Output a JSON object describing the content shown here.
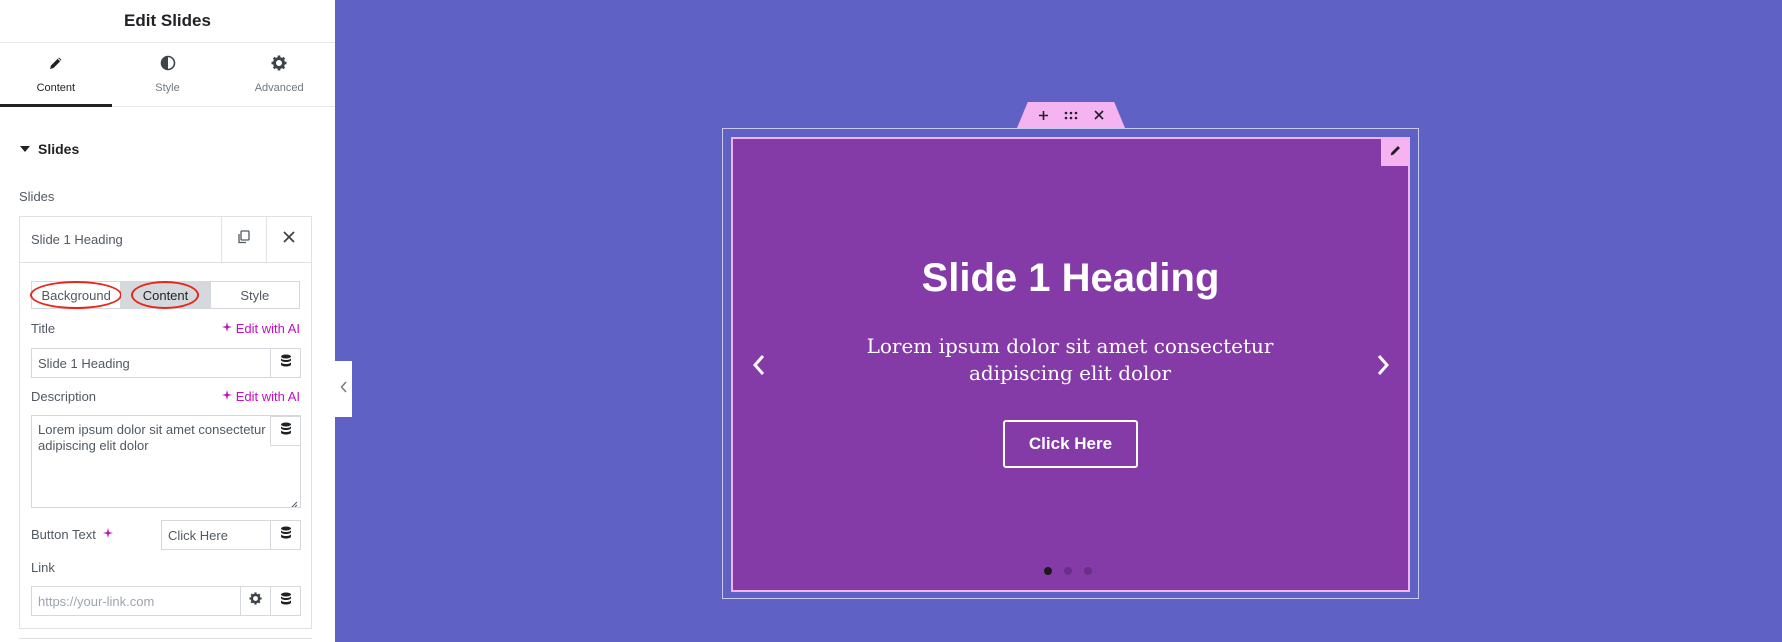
{
  "panel": {
    "title": "Edit Slides",
    "tabs": [
      {
        "label": "Content",
        "icon": "pencil-icon",
        "active": true
      },
      {
        "label": "Style",
        "icon": "half-circle-icon",
        "active": false
      },
      {
        "label": "Advanced",
        "icon": "gear-icon",
        "active": false
      }
    ],
    "section_title": "Slides",
    "slides_caption": "Slides",
    "repeater_item": {
      "title": "Slide 1 Heading",
      "inner_tabs": [
        "Background",
        "Content",
        "Style"
      ],
      "active_inner_tab": "Content",
      "title_label": "Title",
      "edit_with_ai": "Edit with AI",
      "title_value": "Slide 1 Heading",
      "description_label": "Description",
      "description_value": "Lorem ipsum dolor sit amet consectetur adipiscing elit dolor",
      "button_text_label": "Button Text",
      "button_text_value": "Click Here",
      "link_label": "Link",
      "link_placeholder": "https://your-link.com"
    }
  },
  "canvas": {
    "background": "#5f62c4",
    "slide_background": "#853ba7",
    "accent": "#f5b3f1",
    "slide": {
      "heading": "Slide 1 Heading",
      "description": "Lorem ipsum dolor sit amet consectetur adipiscing elit dolor",
      "button_label": "Click Here"
    },
    "pagination": {
      "count": 3,
      "active_index": 0
    }
  }
}
